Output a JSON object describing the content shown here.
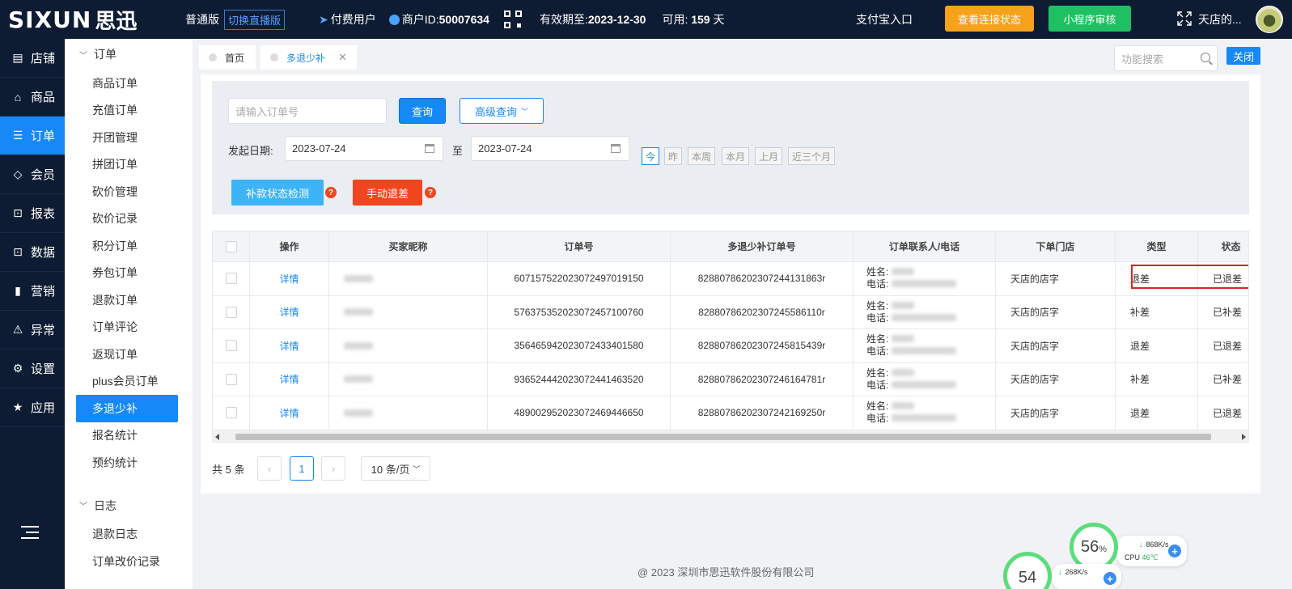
{
  "header": {
    "logo_text": "SIXUN",
    "logo_cn": "思迅",
    "edition": "普通版",
    "switch_label": "切换直播版",
    "paid_user": "付费用户",
    "merchant_label": "商户ID:",
    "merchant_id": "50007634",
    "valid_label": "有效期至:",
    "valid_date": "2023-12-30",
    "avail_label": "可用: ",
    "avail_days": "159",
    "avail_unit": " 天",
    "alipay": "支付宝入口",
    "check_conn": "查看连接状态",
    "miniapp_audit": "小程序审核",
    "shop_name": "天店的..."
  },
  "leftnav": [
    {
      "label": "店铺",
      "icon": "store-icon",
      "glyph": "▤"
    },
    {
      "label": "商品",
      "icon": "gift-icon",
      "glyph": "⌂"
    },
    {
      "label": "订单",
      "icon": "order-icon",
      "glyph": "☰",
      "active": true
    },
    {
      "label": "会员",
      "icon": "diamond-icon",
      "glyph": "◇"
    },
    {
      "label": "报表",
      "icon": "lock-report-icon",
      "glyph": "⊡"
    },
    {
      "label": "数据",
      "icon": "lock-data-icon",
      "glyph": "⊡"
    },
    {
      "label": "营销",
      "icon": "bar-chart-icon",
      "glyph": "▮"
    },
    {
      "label": "异常",
      "icon": "warning-icon",
      "glyph": "⚠"
    },
    {
      "label": "设置",
      "icon": "gear-icon",
      "glyph": "⚙"
    },
    {
      "label": "应用",
      "icon": "star-icon",
      "glyph": "★"
    }
  ],
  "subnav": {
    "group1": "订单",
    "items": [
      "商品订单",
      "充值订单",
      "开团管理",
      "拼团订单",
      "砍价管理",
      "砍价记录",
      "积分订单",
      "券包订单",
      "退款订单",
      "订单评论",
      "返现订单",
      "plus会员订单",
      "多退少补",
      "报名统计",
      "预约统计"
    ],
    "active_index": 12,
    "group2": "日志",
    "log_items": [
      "退款日志",
      "订单改价记录"
    ]
  },
  "tabs": {
    "home": "首页",
    "current": "多退少补",
    "close_glyph": "✕",
    "func_search_placeholder": "功能搜索",
    "close_all": "关闭"
  },
  "filter": {
    "order_placeholder": "请输入订单号",
    "query": "查询",
    "advanced": "高级查询",
    "date_label": "发起日期:",
    "date_from": "2023-07-24",
    "to_label": "至",
    "date_to": "2023-07-24",
    "quick": [
      "今",
      "昨",
      "本周",
      "本月",
      "上月",
      "近三个月"
    ],
    "check_status": "补款状态检测",
    "manual_refund": "手动退差",
    "help_glyph": "?"
  },
  "table": {
    "headers": [
      "操作",
      "买家昵称",
      "订单号",
      "多退少补订单号",
      "订单联系人/电话",
      "下单门店",
      "类型",
      "状态"
    ],
    "name_label": "姓名: ",
    "phone_label": "电话: ",
    "rows": [
      {
        "action": "详情",
        "order_no": "607157522023072497019150",
        "diff_no": "8288078620230724413186​3r",
        "store": "天店的店字",
        "type": "退差",
        "status": "已退差"
      },
      {
        "action": "详情",
        "order_no": "576375352023072457100760",
        "diff_no": "828807862023072455861​10r",
        "store": "天店的店字",
        "type": "补差",
        "status": "已补差"
      },
      {
        "action": "详情",
        "order_no": "356465942023072433401580",
        "diff_no": "828807862023072458154​39r",
        "store": "天店的店字",
        "type": "退差",
        "status": "已退差"
      },
      {
        "action": "详情",
        "order_no": "936524442023072441463520",
        "diff_no": "828807862023072461647​81r",
        "store": "天店的店字",
        "type": "补差",
        "status": "已补差"
      },
      {
        "action": "详情",
        "order_no": "489002952023072469446650",
        "diff_no": "828807862023072421692​50r",
        "store": "天店的店字",
        "type": "退差",
        "status": "已退差"
      }
    ]
  },
  "pagination": {
    "total": "共 5 条",
    "prev": "‹",
    "page": "1",
    "next": "›",
    "page_size": "10 条/页"
  },
  "footer": "@ 2023 深圳市思迅软件股份有限公司",
  "monitor": {
    "gauge1": "56",
    "gauge1_unit": "%",
    "down1": "868K/s",
    "cpu_label": "CPU",
    "cpu_temp": "46℃",
    "gauge2": "54",
    "down2": "268K/s",
    "plus_glyph": "+",
    "arrow_glyph": "↓"
  }
}
